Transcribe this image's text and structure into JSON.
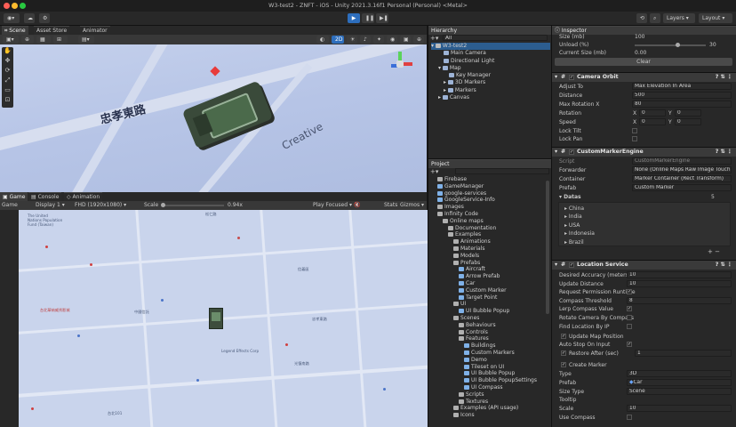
{
  "window": {
    "title": "W3-test2 - ZNFT - iOS - Unity 2021.3.16f1 Personal (Personal) <Metal>"
  },
  "toolbar": {
    "layers": "Layers",
    "layout": "Layout"
  },
  "scene": {
    "tabs": [
      "Scene",
      "Asset Store",
      "Animator"
    ],
    "mode_2d": "2D",
    "street_label": "忠孝東路",
    "creative_label": "Creative"
  },
  "game": {
    "tabs": [
      "Game",
      "Console",
      "Animation"
    ],
    "game_label": "Game",
    "display": "Display 1",
    "resolution": "FHD (1920x1080)",
    "scale_label": "Scale",
    "scale_value": "0.94x",
    "play_focused": "Play Focused",
    "stats": "Stats",
    "gizmos": "Gizmos"
  },
  "hierarchy": {
    "title": "Hierarchy",
    "search_placeholder": "All",
    "items": [
      "W3-test2",
      "Main Camera",
      "Directional Light",
      "Map",
      "Key Manager",
      "3D Markers",
      "Markers",
      "Canvas"
    ]
  },
  "project": {
    "title": "Project",
    "items": [
      "Firebase",
      "GameManager",
      "google-services",
      "GoogleService-Info",
      "Images",
      "Infinity Code",
      "Online maps",
      "Documentation",
      "Examples",
      "Animations",
      "Materials",
      "Models",
      "Prefabs",
      "Aircraft",
      "Arrow Prefab",
      "Car",
      "Custom Marker",
      "Target Point",
      "UI",
      "UI Bubble Popup",
      "Scenes",
      "Behaviours",
      "Controls",
      "Features",
      "Buildings",
      "Custom Markers",
      "Demo",
      "Tileset on UI",
      "UI Bubble Popup",
      "UI Bubble PopupSettings",
      "UI Compass",
      "Scripts",
      "Textures",
      "Examples (API usage)",
      "Icons"
    ]
  },
  "inspector": {
    "title": "Inspector",
    "top": {
      "size_label": "Size (mb)",
      "size_value": "100",
      "unload_label": "Unload (%)",
      "unload_value": "30",
      "current_label": "Current Size (mb)",
      "current_value": "0.00",
      "clear": "Clear"
    },
    "camera_orbit": {
      "title": "Camera Orbit",
      "adjust_to_label": "Adjust To",
      "adjust_to_value": "Max Elevation In Area",
      "distance_label": "Distance",
      "distance_value": "500",
      "max_rotation_label": "Max Rotation X",
      "max_rotation_value": "80",
      "rotation_label": "Rotation",
      "rotation_x": "0",
      "rotation_y": "0",
      "speed_label": "Speed",
      "speed_x": "0",
      "speed_y": "0",
      "lock_tilt": "Lock Tilt",
      "lock_pan": "Lock Pan",
      "x": "X",
      "y": "Y"
    },
    "custom_marker": {
      "title": "CustomMarkerEngine",
      "script_label": "Script",
      "script_value": "CustomMarkerEngine",
      "forwarder_label": "Forwarder",
      "forwarder_value": "None (Online Maps Raw Image Touch F",
      "container_label": "Container",
      "container_value": "Marker Container (Rect Transform)",
      "prefab_label": "Prefab",
      "prefab_value": "Custom Marker",
      "datas_label": "Datas",
      "datas_count": "5",
      "datas": [
        "China",
        "India",
        "USA",
        "Indonesia",
        "Brazil"
      ]
    },
    "location_service": {
      "title": "Location Service",
      "desired_label": "Desired Accuracy (meters)",
      "desired_value": "10",
      "update_distance_label": "Update Distance",
      "update_distance_value": "10",
      "request_label": "Request Permission Runtime",
      "compass_label": "Compass Threshold",
      "compass_value": "8",
      "lerp_label": "Lerp Compass Value",
      "rotate_label": "Rotate Camera By Compass",
      "find_label": "Find Location By IP",
      "update_map_label": "Update Map Position",
      "auto_stop_label": "Auto Stop On Input",
      "restore_label": "Restore After (sec)",
      "restore_value": "1",
      "create_marker_label": "Create Marker",
      "type_label": "Type",
      "type_value": "3D",
      "prefab_label": "Prefab",
      "prefab_value": "Car",
      "size_type_label": "Size Type",
      "size_type_value": "Scene",
      "tooltip_label": "Tooltip",
      "scale_label": "Scale",
      "scale_value": "10",
      "use_compass_label": "Use Compass"
    }
  },
  "game_map": {
    "labels": [
      "The United Nations Population Fund (Taiwan)",
      "台北華納威秀影城",
      "台北101",
      "Legend Effects Corp",
      "信義區",
      "松仁路",
      "中國信託",
      "光復南路",
      "忠孝東路"
    ]
  },
  "colors": {
    "accent": "#2d6ebd",
    "scene_bg": "#b8c6e6",
    "map_bg": "#c9d4ec",
    "play_blue": "#1b4f94"
  }
}
